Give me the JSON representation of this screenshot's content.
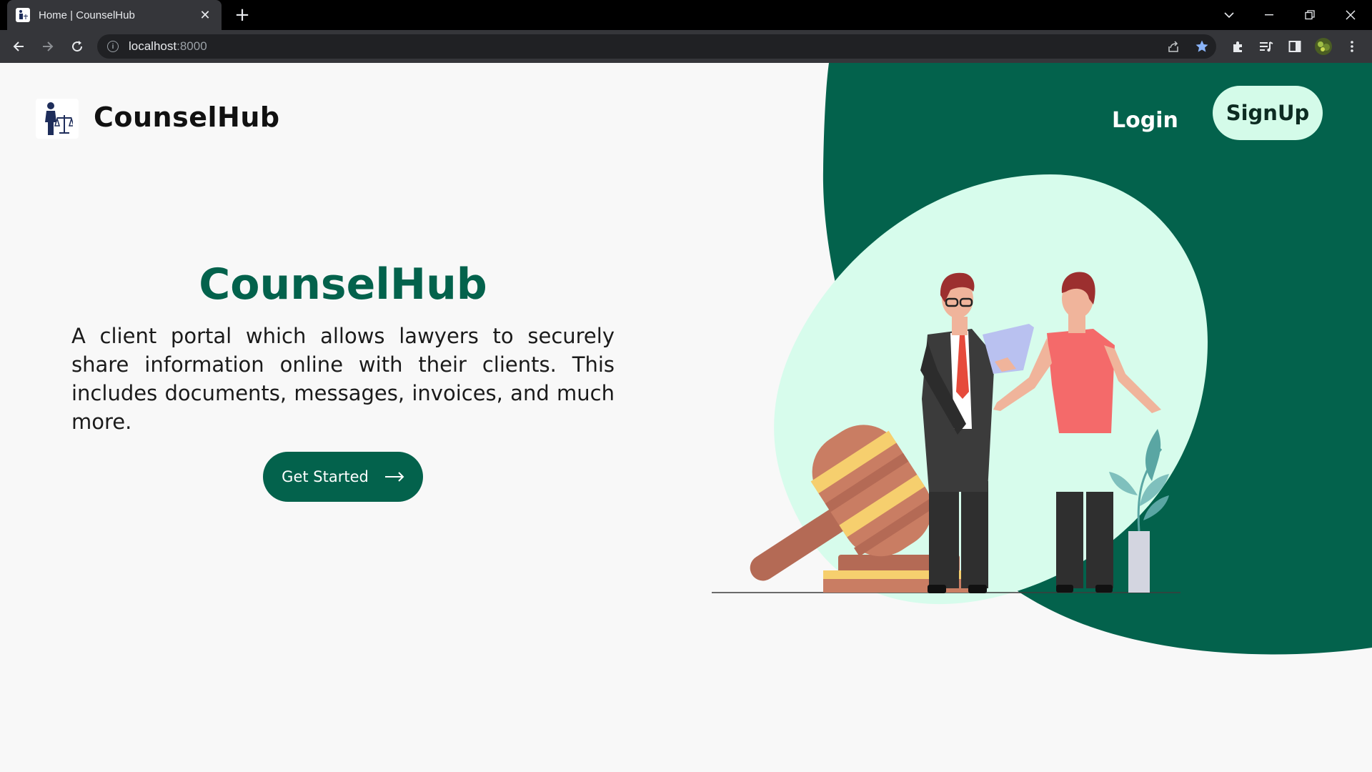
{
  "browser": {
    "tab_title": "Home | CounselHub",
    "url_host": "localhost",
    "url_port": ":8000"
  },
  "nav": {
    "brand": "CounselHub",
    "login": "Login",
    "signup": "SignUp"
  },
  "hero": {
    "title": "CounselHub",
    "description": "A client portal which allows lawyers to securely share information online with their clients. This includes documents, messages, invoices, and much more.",
    "cta": "Get Started"
  },
  "colors": {
    "brand_green": "#03624c",
    "mint": "#d4fbe9",
    "page_bg": "#f8f8f8"
  }
}
